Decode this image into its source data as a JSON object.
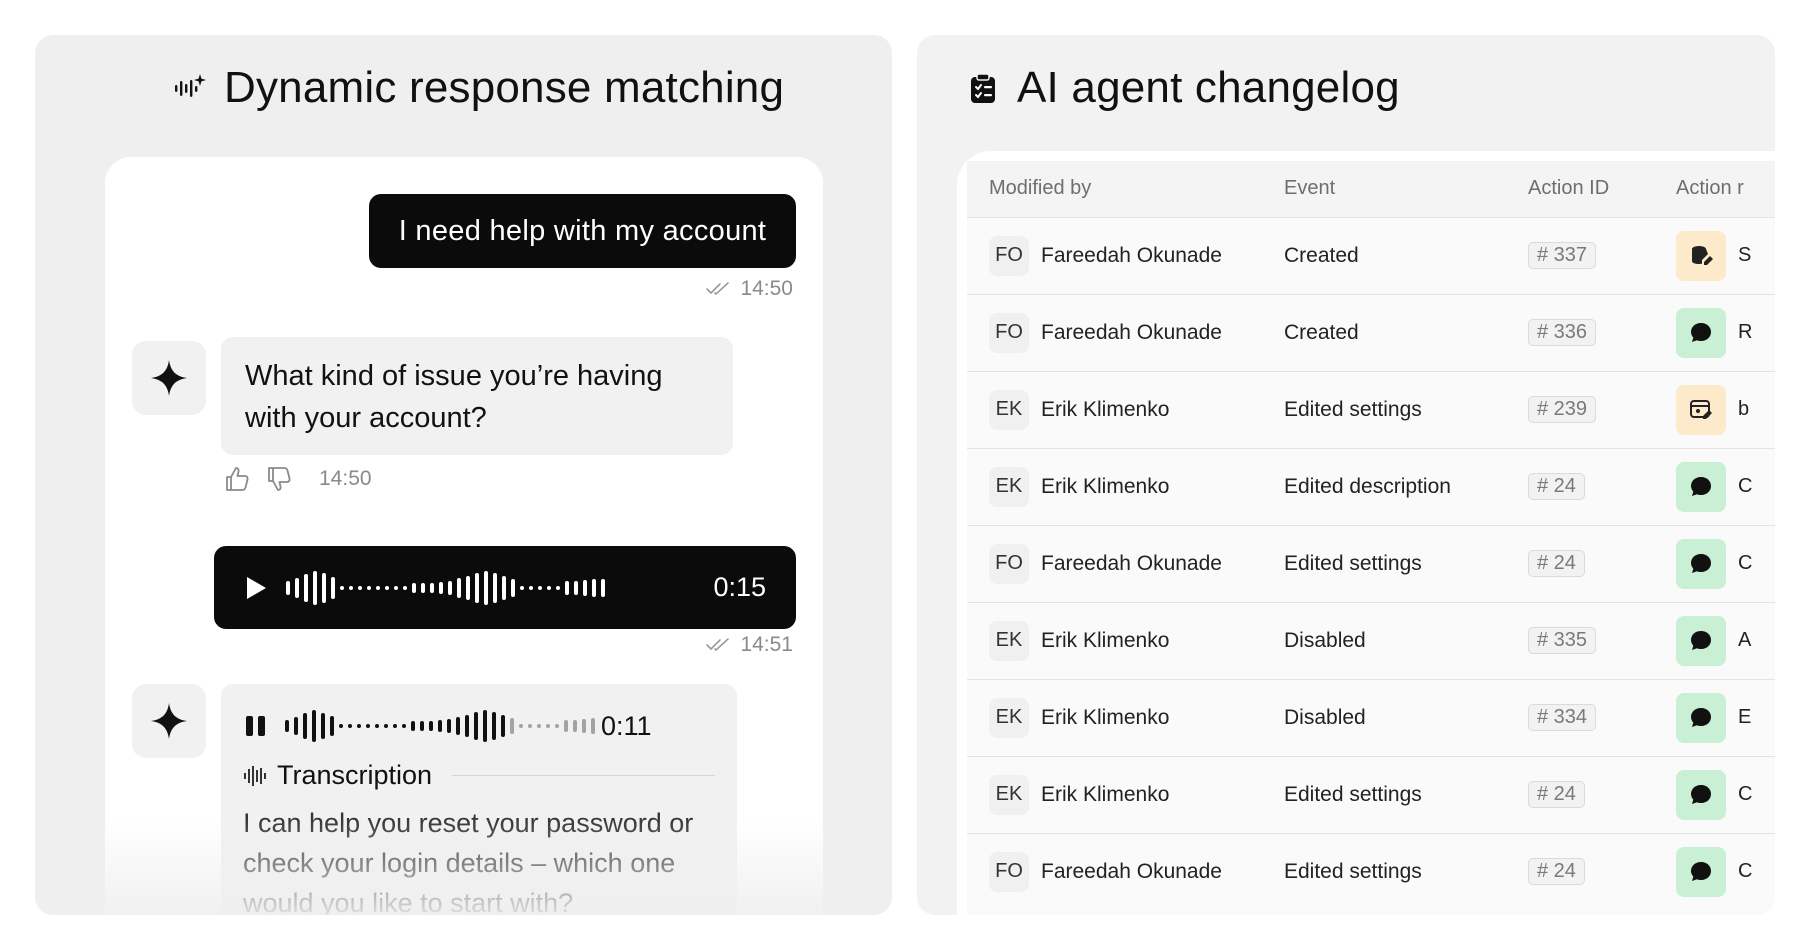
{
  "left_panel": {
    "title": "Dynamic response matching",
    "title_icon": "sparkle-waveform-icon",
    "messages": {
      "user_text": "I need help with my account",
      "user_text_time": "14:50",
      "ai_text": "What kind of issue you’re having with your account?",
      "ai_text_time": "14:50",
      "user_voice_duration": "0:15",
      "user_voice_time": "14:51",
      "ai_voice_duration": "0:11",
      "transcription_label": "Transcription",
      "transcription_text": "I can help you reset your password or check your login details – which one would you like to start with?"
    },
    "icons": {
      "ai_avatar": "four-point-star-icon",
      "read_receipt": "double-check-icon",
      "like": "thumbs-up-icon",
      "dislike": "thumbs-down-icon",
      "play": "play-icon",
      "pause": "pause-icon",
      "transcription": "soundwave-icon"
    }
  },
  "right_panel": {
    "title": "AI agent changelog",
    "title_icon": "clipboard-check-icon",
    "columns": [
      "Modified by",
      "Event",
      "Action ID",
      "Action r"
    ],
    "rows": [
      {
        "initials": "FO",
        "name": "Fareedah Okunade",
        "event": "Created",
        "id": "# 337",
        "action_icon": "database-edit-icon",
        "action_color": "orange",
        "action_letter": "S"
      },
      {
        "initials": "FO",
        "name": "Fareedah Okunade",
        "event": "Created",
        "id": "# 336",
        "action_icon": "chat-bubble-icon",
        "action_color": "green",
        "action_letter": "R"
      },
      {
        "initials": "EK",
        "name": "Erik Klimenko",
        "event": "Edited settings",
        "id": "# 239",
        "action_icon": "browser-edit-icon",
        "action_color": "orange",
        "action_letter": "b"
      },
      {
        "initials": "EK",
        "name": "Erik Klimenko",
        "event": "Edited description",
        "id": "# 24",
        "action_icon": "chat-bubble-icon",
        "action_color": "green",
        "action_letter": "C"
      },
      {
        "initials": "FO",
        "name": "Fareedah Okunade",
        "event": "Edited settings",
        "id": "# 24",
        "action_icon": "chat-bubble-icon",
        "action_color": "green",
        "action_letter": "C"
      },
      {
        "initials": "EK",
        "name": "Erik Klimenko",
        "event": "Disabled",
        "id": "# 335",
        "action_icon": "chat-bubble-icon",
        "action_color": "green",
        "action_letter": "A"
      },
      {
        "initials": "EK",
        "name": "Erik Klimenko",
        "event": "Disabled",
        "id": "# 334",
        "action_icon": "chat-bubble-icon",
        "action_color": "green",
        "action_letter": "E"
      },
      {
        "initials": "EK",
        "name": "Erik Klimenko",
        "event": "Edited settings",
        "id": "# 24",
        "action_icon": "chat-bubble-icon",
        "action_color": "green",
        "action_letter": "C"
      },
      {
        "initials": "FO",
        "name": "Fareedah Okunade",
        "event": "Edited settings",
        "id": "# 24",
        "action_icon": "chat-bubble-icon",
        "action_color": "green",
        "action_letter": "C"
      }
    ]
  },
  "colors": {
    "panel_bg": "#efefef",
    "user_bubble": "#0b0b0b",
    "ai_bubble": "#f1f1f1",
    "action_green": "#c9f0d4",
    "action_orange": "#fdeacb"
  }
}
